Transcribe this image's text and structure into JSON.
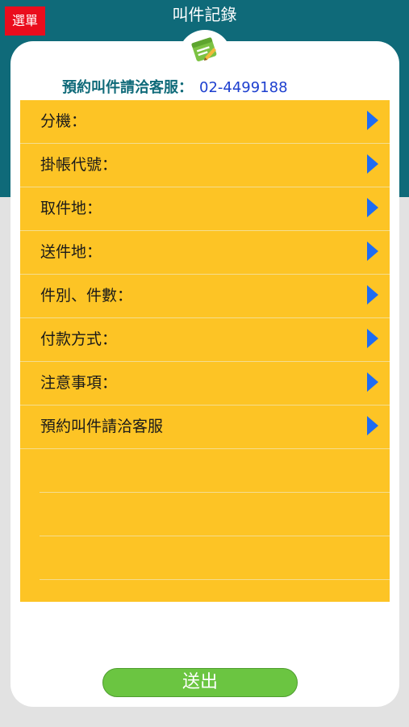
{
  "header": {
    "title": "叫件記錄",
    "menu_label": "選單"
  },
  "hotline": {
    "label": "預約叫件請洽客服：",
    "number": "02-4499188"
  },
  "form": {
    "rows": [
      {
        "label": "分機：",
        "icon": "chevron-right-icon"
      },
      {
        "label": "掛帳代號：",
        "icon": "chevron-right-icon"
      },
      {
        "label": "取件地：",
        "icon": "chevron-right-icon"
      },
      {
        "label": "送件地：",
        "icon": "chevron-right-icon"
      },
      {
        "label": "件別、件數：",
        "icon": "chevron-right-icon"
      },
      {
        "label": "付款方式：",
        "icon": "chevron-right-icon"
      },
      {
        "label": "注意事項：",
        "icon": "chevron-right-icon"
      },
      {
        "label": "預約叫件請洽客服",
        "icon": "chevron-right-icon"
      }
    ]
  },
  "submit_label": "送出",
  "logo_icon": "notepad-pencil-icon",
  "colors": {
    "header_band": "#0f6a79",
    "menu_button": "#ea0d1d",
    "form_panel": "#fdc425",
    "arrow": "#1e6cf2",
    "submit_button": "#6bc541",
    "hotline_number": "#1d3fcf"
  }
}
